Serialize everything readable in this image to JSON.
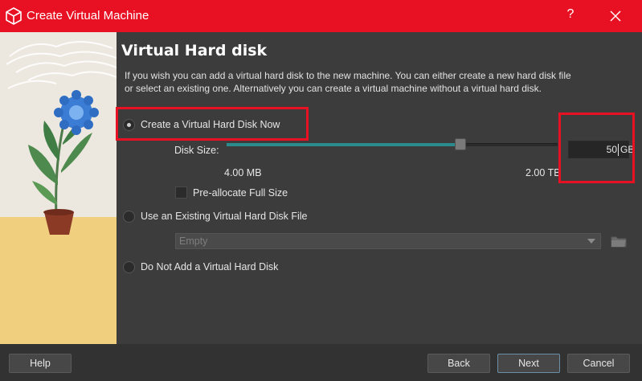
{
  "window": {
    "title": "Create Virtual Machine",
    "help_glyph": "?",
    "close_icon": "close-icon",
    "title_bar_color": "#e81123"
  },
  "page": {
    "heading": "Virtual Hard disk",
    "description": "If you wish you can add a virtual hard disk to the new machine. You can either create a new hard disk file or select an existing one. Alternatively you can create a virtual machine without a virtual hard disk."
  },
  "options": {
    "create_now": {
      "label": "Create a Virtual Hard Disk Now",
      "checked": true
    },
    "use_existing": {
      "label": "Use an Existing Virtual Hard Disk File",
      "checked": false
    },
    "do_not_add": {
      "label": "Do Not Add a Virtual Hard Disk",
      "checked": false
    }
  },
  "disk_size": {
    "label": "Disk Size:",
    "min_label": "4.00 MB",
    "max_label": "2.00 TB",
    "value": "50",
    "unit": "GB",
    "slider_position_fraction": 0.7
  },
  "preallocate": {
    "label": "Pre-allocate Full Size",
    "checked": false
  },
  "existing_file": {
    "selected": "Empty",
    "folder_icon": "folder-icon"
  },
  "buttons": {
    "help": "Help",
    "back": "Back",
    "next": "Next",
    "cancel": "Cancel"
  },
  "annotation_color": "#e81123"
}
